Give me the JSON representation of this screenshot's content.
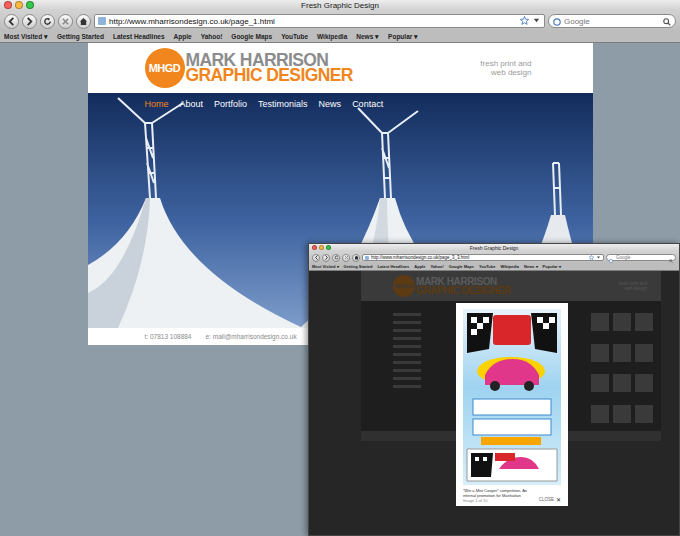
{
  "browser": {
    "title": "Fresh Graphic Design",
    "url": "http://www.mharrisondesign.co.uk/page_1.html",
    "search_placeholder": "Google",
    "bookmarks": [
      "Most Visited ▾",
      "Getting Started",
      "Latest Headlines",
      "Apple",
      "Yahoo!",
      "Google Maps",
      "YouTube",
      "Wikipedia",
      "News ▾",
      "Popular ▾"
    ]
  },
  "site": {
    "logo_mark": "MHGD",
    "name_line1": "MARK HARRISON",
    "name_line2": "GRAPHIC DESIGNER",
    "tagline": [
      "fresh print and",
      "web design"
    ],
    "nav": [
      {
        "label": "Home",
        "selected": true
      },
      {
        "label": "About",
        "selected": false
      },
      {
        "label": "Portfolio",
        "selected": false
      },
      {
        "label": "Testimonials",
        "selected": false
      },
      {
        "label": "News",
        "selected": false
      },
      {
        "label": "Contact",
        "selected": false
      }
    ],
    "footer_phone": "t: 07813 108884",
    "footer_email": "e: mail@mharrisondesign.co.uk"
  },
  "popup_window": {
    "title": "Fresh Graphic Design",
    "url": "http://www.mharrisondesign.co.uk/page_3_3.html",
    "search_placeholder": "Google",
    "bookmarks": [
      "Most Visited ▾",
      "Getting Started",
      "Latest Headlines",
      "Apple",
      "Yahoo!",
      "Google Maps",
      "YouTube",
      "Wikipedia",
      "News ▾",
      "Popular ▾"
    ],
    "site": {
      "logo_mark": "MHGD",
      "name_line1": "MARK HARRISON",
      "name_line2": "GRAPHIC DESIGNER",
      "tagline": [
        "fresh print and",
        "web design"
      ]
    },
    "lightbox": {
      "caption": "“Win a Mini Cooper” competition. An internal promotion for Manhattan",
      "counter": "Image 1 of 10",
      "close": "CLOSE",
      "close_icon": "✕"
    }
  }
}
